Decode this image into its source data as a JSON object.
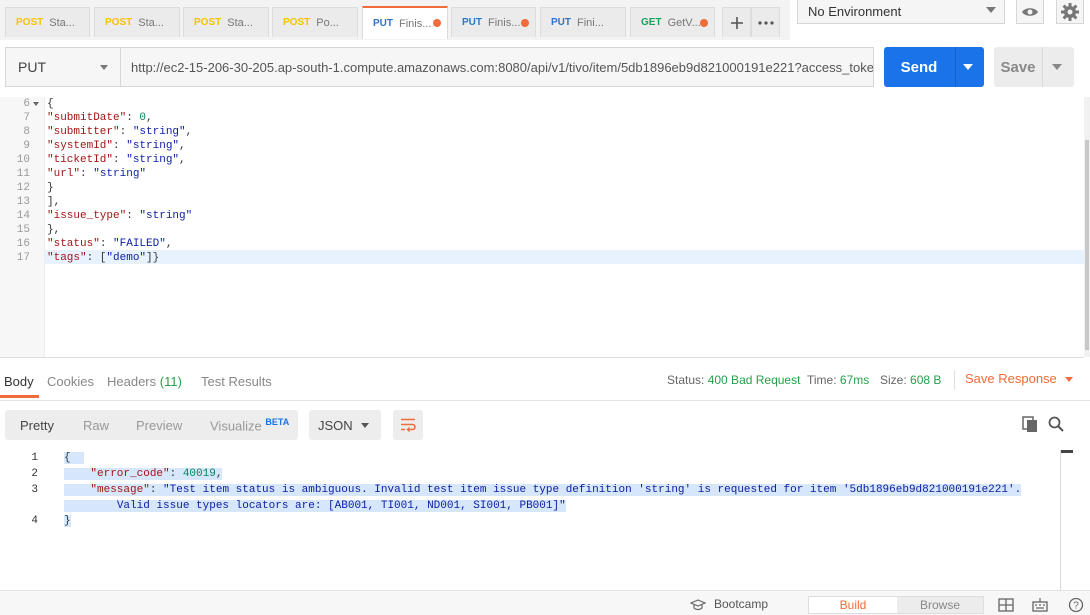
{
  "tabs": [
    {
      "method": "POST",
      "label": "Sta...",
      "modified": false,
      "active": false
    },
    {
      "method": "POST",
      "label": "Sta...",
      "modified": false,
      "active": false
    },
    {
      "method": "POST",
      "label": "Sta...",
      "modified": false,
      "active": false
    },
    {
      "method": "POST",
      "label": "Po...",
      "modified": false,
      "active": false
    },
    {
      "method": "PUT",
      "label": "Finis...",
      "modified": true,
      "active": true
    },
    {
      "method": "PUT",
      "label": "Finis...",
      "modified": true,
      "active": false
    },
    {
      "method": "PUT",
      "label": "Fini...",
      "modified": false,
      "active": false
    },
    {
      "method": "GET",
      "label": "GetV...",
      "modified": true,
      "active": false
    }
  ],
  "environment": {
    "selected": "No Environment"
  },
  "request": {
    "method": "PUT",
    "url": "http://ec2-15-206-30-205.ap-south-1.compute.amazonaws.com:8080/api/v1/tivo/item/5db1896eb9d821000191e221?access_toke...",
    "send_label": "Send",
    "save_label": "Save",
    "body_lines": [
      {
        "n": "6",
        "text": "{",
        "fold": true
      },
      {
        "n": "7",
        "text": "\"submitDate\": 0,"
      },
      {
        "n": "8",
        "text": "\"submitter\": \"string\","
      },
      {
        "n": "9",
        "text": "\"systemId\": \"string\","
      },
      {
        "n": "10",
        "text": "\"ticketId\": \"string\","
      },
      {
        "n": "11",
        "text": "\"url\": \"string\""
      },
      {
        "n": "12",
        "text": "}"
      },
      {
        "n": "13",
        "text": "],"
      },
      {
        "n": "14",
        "text": "\"issue_type\": \"string\""
      },
      {
        "n": "15",
        "text": "},"
      },
      {
        "n": "16",
        "text": "\"status\": \"FAILED\","
      },
      {
        "n": "17",
        "text": "\"tags\": [\"demo\"]}"
      }
    ]
  },
  "response": {
    "tabs": {
      "body": "Body",
      "cookies": "Cookies",
      "headers": "Headers",
      "headers_count": "(11)",
      "tests": "Test Results"
    },
    "status_label": "Status:",
    "status_value": "400 Bad Request",
    "time_label": "Time:",
    "time_value": "67ms",
    "size_label": "Size:",
    "size_value": "608 B",
    "save_response": "Save Response",
    "views": {
      "pretty": "Pretty",
      "raw": "Raw",
      "preview": "Preview",
      "visualize": "Visualize",
      "beta": "BETA"
    },
    "format": "JSON",
    "body_line_numbers": [
      "1",
      "2",
      "3",
      "4"
    ],
    "body": {
      "open": "{",
      "error_code_key": "\"error_code\"",
      "error_code_value": "40019",
      "message_key": "\"message\"",
      "message_value_1": "\"Test item status is ambiguous. Invalid test item issue type definition 'string' is requested for item '5db1896eb9d821000191e221'.",
      "message_value_2": "Valid issue types locators are: [AB001, TI001, ND001, SI001, PB001]\"",
      "close": "}"
    }
  },
  "footer": {
    "bootcamp": "Bootcamp",
    "build": "Build",
    "browse": "Browse"
  },
  "colors": {
    "accent": "#f26b3a",
    "send": "#1a73e8",
    "status_green": "#26a04a",
    "post": "#f5c300",
    "put": "#2c76c8",
    "get": "#17a35b"
  }
}
